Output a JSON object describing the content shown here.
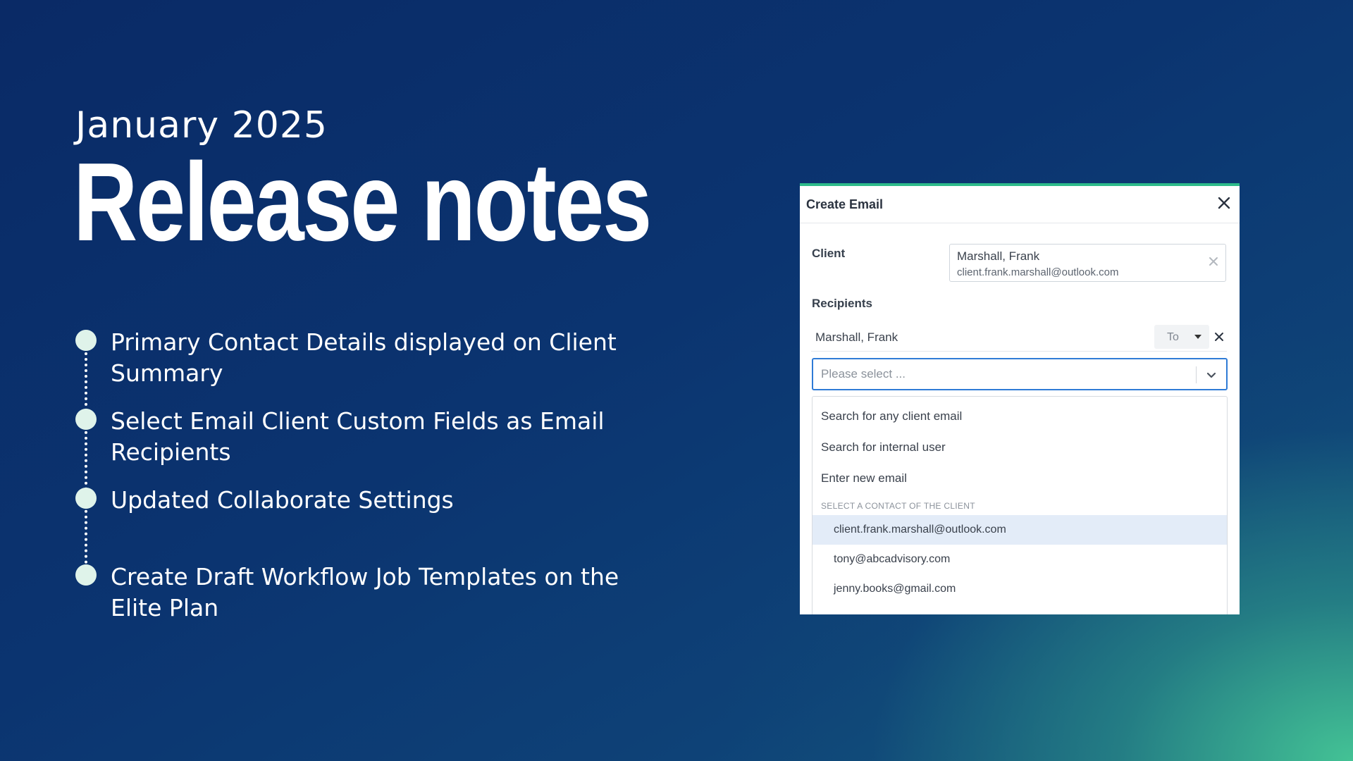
{
  "hero": {
    "subtitle": "January 2025",
    "title": "Release notes"
  },
  "features": [
    "Primary Contact Details displayed on Client Summary",
    "Select Email Client Custom Fields as Email Recipients",
    "Updated Collaborate Settings",
    "Create Draft Workflow Job Templates on the Elite Plan"
  ],
  "dialog": {
    "title": "Create Email",
    "client_label": "Client",
    "client_name": "Marshall, Frank",
    "client_email": "client.frank.marshall@outlook.com",
    "recipients_label": "Recipients",
    "recipient_name": "Marshall, Frank",
    "recipient_type": "To",
    "select_placeholder": "Please select ...",
    "options": [
      "Search for any client email",
      "Search for internal user",
      "Enter new email"
    ],
    "group_label": "SELECT A CONTACT OF THE CLIENT",
    "contacts": [
      "client.frank.marshall@outlook.com",
      "tony@abcadvisory.com",
      "jenny.books@gmail.com"
    ]
  },
  "colors": {
    "accent_green": "#2dbb8a",
    "focus_blue": "#2f7bd6",
    "highlight": "#e3ecf8"
  }
}
